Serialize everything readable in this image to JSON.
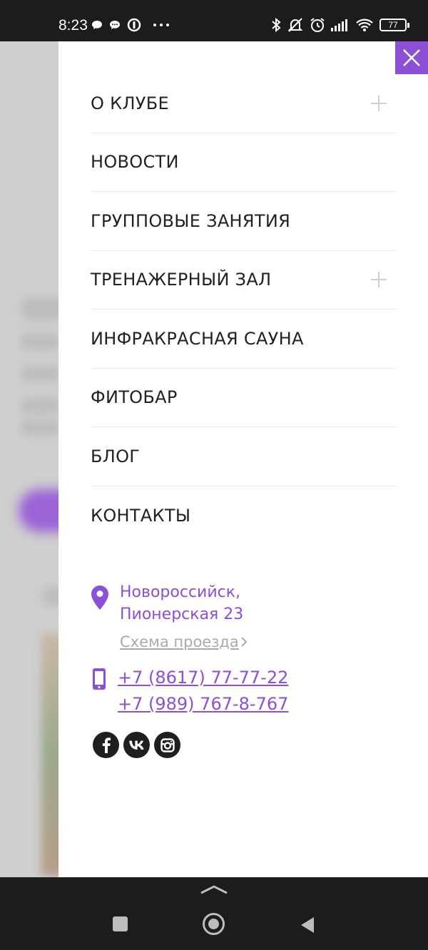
{
  "status_bar": {
    "time": "8:23",
    "left_icons": [
      "chat-bubble-icon",
      "messenger-icon",
      "vpn-icon",
      "more-dots-icon"
    ],
    "right_icons": [
      "bluetooth-icon",
      "mute-icon",
      "alarm-icon",
      "signal-icon",
      "wifi-icon"
    ],
    "battery": "77"
  },
  "drawer": {
    "close_icon": "close-icon",
    "menu": [
      {
        "label": "О КЛУБЕ",
        "expandable": true
      },
      {
        "label": "НОВОСТИ",
        "expandable": false
      },
      {
        "label": "ГРУППОВЫЕ ЗАНЯТИЯ",
        "expandable": false
      },
      {
        "label": "ТРЕНАЖЕРНЫЙ ЗАЛ",
        "expandable": true
      },
      {
        "label": "ИНФРАКРАСНАЯ САУНА",
        "expandable": false
      },
      {
        "label": "ФИТОБАР",
        "expandable": false
      },
      {
        "label": "БЛОГ",
        "expandable": false
      },
      {
        "label": "КОНТАКТЫ",
        "expandable": false
      }
    ],
    "contacts": {
      "address_line1": "Новороссийск,",
      "address_line2": "Пионерская 23",
      "route_link": "Схема проезда",
      "phone1": "+7 (8617) 77-77-22",
      "phone2": "+7 (989) 767-8-767"
    },
    "socials": [
      "facebook-icon",
      "vk-icon",
      "instagram-icon"
    ]
  },
  "colors": {
    "accent": "#8c4fd8",
    "text": "#222222",
    "muted": "#aaaaaa"
  }
}
